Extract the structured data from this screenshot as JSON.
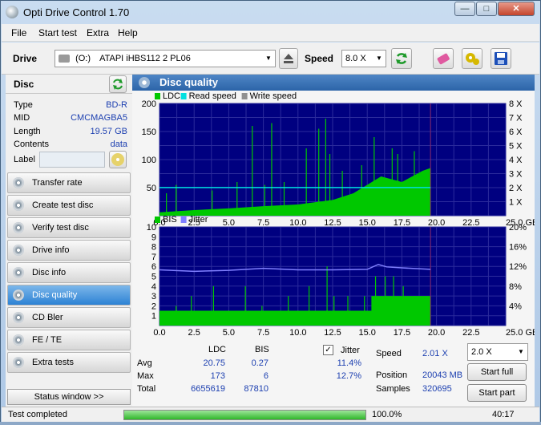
{
  "window": {
    "title": "Opti Drive Control 1.70",
    "min": "—",
    "max": "□",
    "close": "✕"
  },
  "menu": [
    "File",
    "Start test",
    "Extra",
    "Help"
  ],
  "toolbar": {
    "drive_label": "Drive",
    "drive_letter": "(O:)",
    "drive_value": "ATAPI  iHBS112   2 PL06",
    "speed_label": "Speed",
    "speed_value": "8.0 X"
  },
  "disc": {
    "heading": "Disc",
    "fields": [
      {
        "k": "Type",
        "v": "BD-R"
      },
      {
        "k": "MID",
        "v": "CMCMAGBA5"
      },
      {
        "k": "Length",
        "v": "19.57 GB"
      },
      {
        "k": "Contents",
        "v": "data"
      },
      {
        "k": "Label",
        "v": ""
      }
    ]
  },
  "sidebar": {
    "items": [
      {
        "label": "Transfer rate",
        "icon": "disc-icon"
      },
      {
        "label": "Create test disc",
        "icon": "disc-icon"
      },
      {
        "label": "Verify test disc",
        "icon": "disc-icon"
      },
      {
        "label": "Drive info",
        "icon": "disc-icon"
      },
      {
        "label": "Disc info",
        "icon": "disc-icon"
      },
      {
        "label": "Disc quality",
        "icon": "disc-icon",
        "active": true
      },
      {
        "label": "CD Bler",
        "icon": "disc-icon"
      },
      {
        "label": "FE / TE",
        "icon": "disc-icon"
      },
      {
        "label": "Extra tests",
        "icon": "disc-icon"
      }
    ],
    "status_window": "Status window >>"
  },
  "panel": {
    "title": "Disc quality"
  },
  "chart_data": [
    {
      "type": "area",
      "legend": [
        "LDC",
        "Read speed",
        "Write speed"
      ],
      "colors": {
        "LDC": "#00c800",
        "Read speed": "#00e0e0",
        "Write speed": "#909090",
        "bg": "#000080",
        "grid": "#2d2d9a"
      },
      "x_ticks": [
        "0.0",
        "2.5",
        "5.0",
        "7.5",
        "10.0",
        "12.5",
        "15.0",
        "17.5",
        "20.0",
        "22.5",
        "25.0 GB"
      ],
      "xlim": [
        0,
        25
      ],
      "y_left_ticks": [
        "200",
        "150",
        "100",
        "50"
      ],
      "ylim": [
        0,
        200
      ],
      "y_right_ticks": [
        "8 X",
        "7 X",
        "6 X",
        "5 X",
        "4 X",
        "3 X",
        "2 X",
        "1 X"
      ],
      "y_right_lim": [
        0,
        8
      ],
      "ldc_base": [
        [
          0,
          6
        ],
        [
          2.5,
          10
        ],
        [
          5,
          13
        ],
        [
          7.5,
          17
        ],
        [
          10,
          20
        ],
        [
          12.5,
          28
        ],
        [
          14,
          40
        ],
        [
          15,
          55
        ],
        [
          16,
          70
        ],
        [
          17.5,
          60
        ],
        [
          19,
          80
        ],
        [
          19.57,
          85
        ]
      ],
      "ldc_spikes": [
        [
          0.5,
          40
        ],
        [
          1.2,
          55
        ],
        [
          3.8,
          45
        ],
        [
          5.6,
          60
        ],
        [
          6.7,
          160
        ],
        [
          7.6,
          55
        ],
        [
          8.1,
          165
        ],
        [
          9.0,
          60
        ],
        [
          10.6,
          120
        ],
        [
          11.5,
          155
        ],
        [
          12.0,
          173
        ],
        [
          12.3,
          110
        ],
        [
          13.2,
          80
        ],
        [
          14.6,
          90
        ],
        [
          15.5,
          140
        ],
        [
          16.8,
          120
        ],
        [
          17.2,
          110
        ],
        [
          18.4,
          115
        ]
      ],
      "read_speed": 2.01,
      "data_end": 19.57
    },
    {
      "type": "area",
      "legend": [
        "BIS",
        "Jitter"
      ],
      "colors": {
        "BIS": "#00c800",
        "Jitter": "#8080ff",
        "bg": "#000080"
      },
      "x_ticks": [
        "0.0",
        "2.5",
        "5.0",
        "7.5",
        "10.0",
        "12.5",
        "15.0",
        "17.5",
        "20.0",
        "22.5",
        "25.0 GB"
      ],
      "xlim": [
        0,
        25
      ],
      "y_left_ticks": [
        "10",
        "9",
        "8",
        "7",
        "6",
        "5",
        "4",
        "3",
        "2",
        "1"
      ],
      "ylim": [
        0,
        10
      ],
      "y_right_ticks": [
        "20%",
        "16%",
        "12%",
        "8%",
        "4%"
      ],
      "y_right_lim": [
        0,
        20
      ],
      "bis_base": 1.5,
      "bis_spikes": [
        [
          1.2,
          2
        ],
        [
          2.3,
          3
        ],
        [
          3.9,
          4
        ],
        [
          6.2,
          4
        ],
        [
          7.4,
          2
        ],
        [
          9.3,
          3
        ],
        [
          10.8,
          4
        ],
        [
          12.1,
          6
        ],
        [
          12.6,
          3
        ],
        [
          13.6,
          3
        ],
        [
          14.8,
          3
        ],
        [
          15.6,
          5
        ],
        [
          16.3,
          5
        ],
        [
          16.9,
          5
        ],
        [
          17.6,
          4
        ],
        [
          18.4,
          3
        ]
      ],
      "bis_dense_from": 15.3,
      "bis_dense_level": 3,
      "jitter": [
        [
          0,
          11.3
        ],
        [
          2.5,
          11.0
        ],
        [
          5,
          11.2
        ],
        [
          7.5,
          11.6
        ],
        [
          10,
          11.3
        ],
        [
          12.5,
          11.3
        ],
        [
          15,
          11.4
        ],
        [
          15.8,
          12.4
        ],
        [
          16.4,
          11.9
        ],
        [
          17.5,
          11.7
        ],
        [
          19.57,
          11.4
        ]
      ],
      "data_end": 19.57
    }
  ],
  "stats": {
    "col_ldc": "LDC",
    "col_bis": "BIS",
    "jitter_label": "Jitter",
    "rows": [
      {
        "label": "Avg",
        "ldc": "20.75",
        "bis": "0.27",
        "jitter": "11.4%"
      },
      {
        "label": "Max",
        "ldc": "173",
        "bis": "6",
        "jitter": "12.7%"
      },
      {
        "label": "Total",
        "ldc": "6655619",
        "bis": "87810",
        "jitter": ""
      }
    ],
    "speed_label": "Speed",
    "speed_value": "2.01 X",
    "position_label": "Position",
    "position_value": "20043 MB",
    "samples_label": "Samples",
    "samples_value": "320695",
    "speed_select": "2.0 X",
    "start_full": "Start full",
    "start_part": "Start part"
  },
  "status": {
    "text": "Test completed",
    "progress": "100.0%",
    "progress_fraction": 1.0,
    "time": "40:17"
  }
}
